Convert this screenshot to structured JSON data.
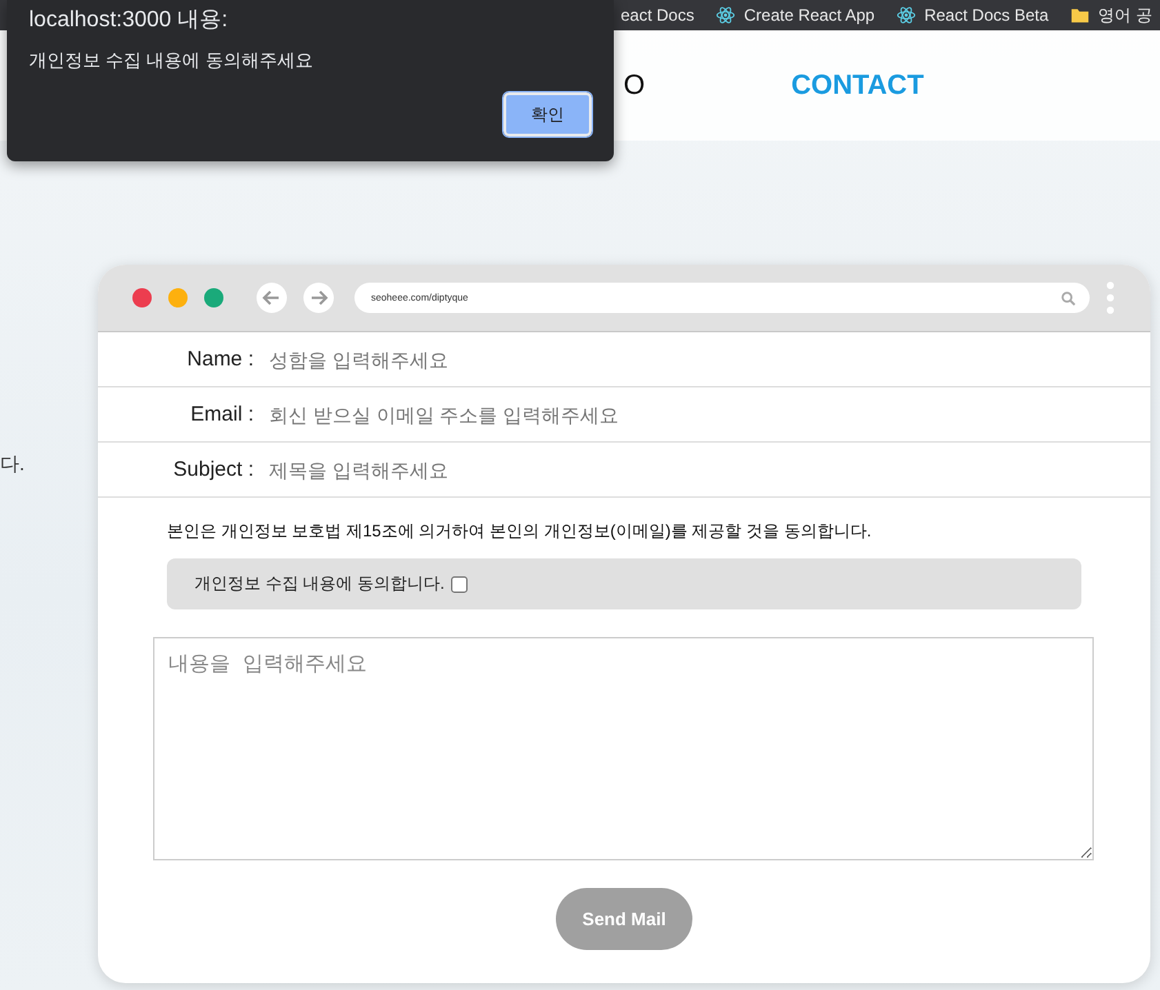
{
  "bookmarks": [
    {
      "label": "eact Docs",
      "kind": "plain"
    },
    {
      "label": "Create React App",
      "kind": "react"
    },
    {
      "label": "React Docs Beta",
      "kind": "react"
    },
    {
      "label": "영어 공",
      "kind": "folder"
    }
  ],
  "nav": [
    {
      "label": "O",
      "selected": false
    },
    {
      "label": "CONTACT",
      "selected": true
    }
  ],
  "side_text": "다.",
  "browser_mockup": {
    "url": "seoheee.com/diptyque"
  },
  "fields": [
    {
      "label": "Name :",
      "placeholder": "성함을 입력해주세요"
    },
    {
      "label": "Email :",
      "placeholder": "회신 받으실 이메일 주소를 입력해주세요"
    },
    {
      "label": "Subject :",
      "placeholder": "제목을 입력해주세요"
    }
  ],
  "consent_text": "본인은 개인정보 보호법 제15조에 의거하여 본인의 개인정보(이메일)를 제공할 것을 동의합니다.",
  "consent_box": {
    "label": "개인정보 수집 내용에 동의합니다.",
    "checked": false
  },
  "message": {
    "placeholder": "내용을 입력해주세요"
  },
  "send_button": "Send Mail",
  "dialog": {
    "title": "localhost:3000 내용:",
    "message": "개인정보 수집 내용에 동의해주세요",
    "button": "확인"
  }
}
